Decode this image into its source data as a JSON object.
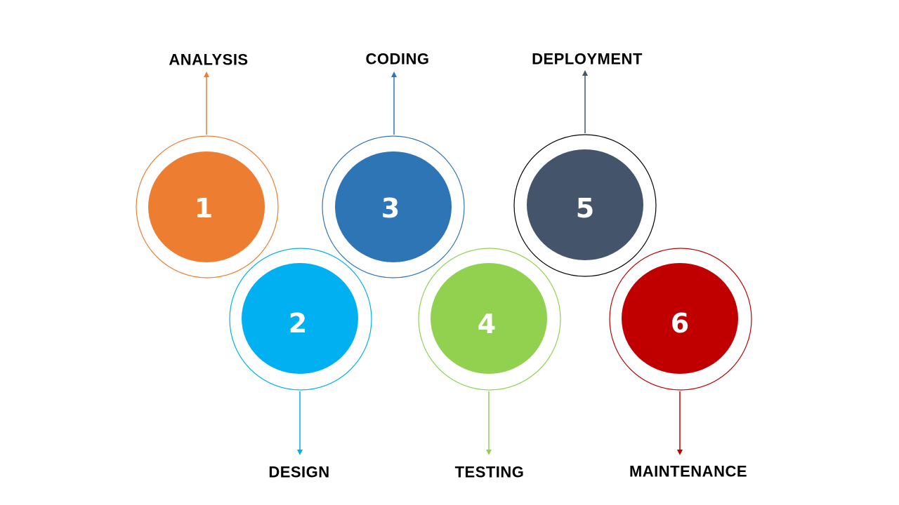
{
  "diagram": {
    "stages": [
      {
        "number": "1",
        "label": "ANALYSIS",
        "color": "#ED7D31",
        "ring_color": "#ED7D31",
        "label_position": "above"
      },
      {
        "number": "2",
        "label": "DESIGN",
        "color": "#00B0F0",
        "ring_color": "#00B0F0",
        "label_position": "below"
      },
      {
        "number": "3",
        "label": "CODING",
        "color": "#2E75B6",
        "ring_color": "#2E75B6",
        "label_position": "above"
      },
      {
        "number": "4",
        "label": "TESTING",
        "color": "#92D050",
        "ring_color": "#92D050",
        "label_position": "below"
      },
      {
        "number": "5",
        "label": "DEPLOYMENT",
        "color": "#44546A",
        "ring_color": "#000000",
        "arrow_color": "#44546A",
        "label_position": "above"
      },
      {
        "number": "6",
        "label": "MAINTENANCE",
        "color": "#C00000",
        "ring_color": "#C00000",
        "label_position": "below"
      }
    ]
  }
}
